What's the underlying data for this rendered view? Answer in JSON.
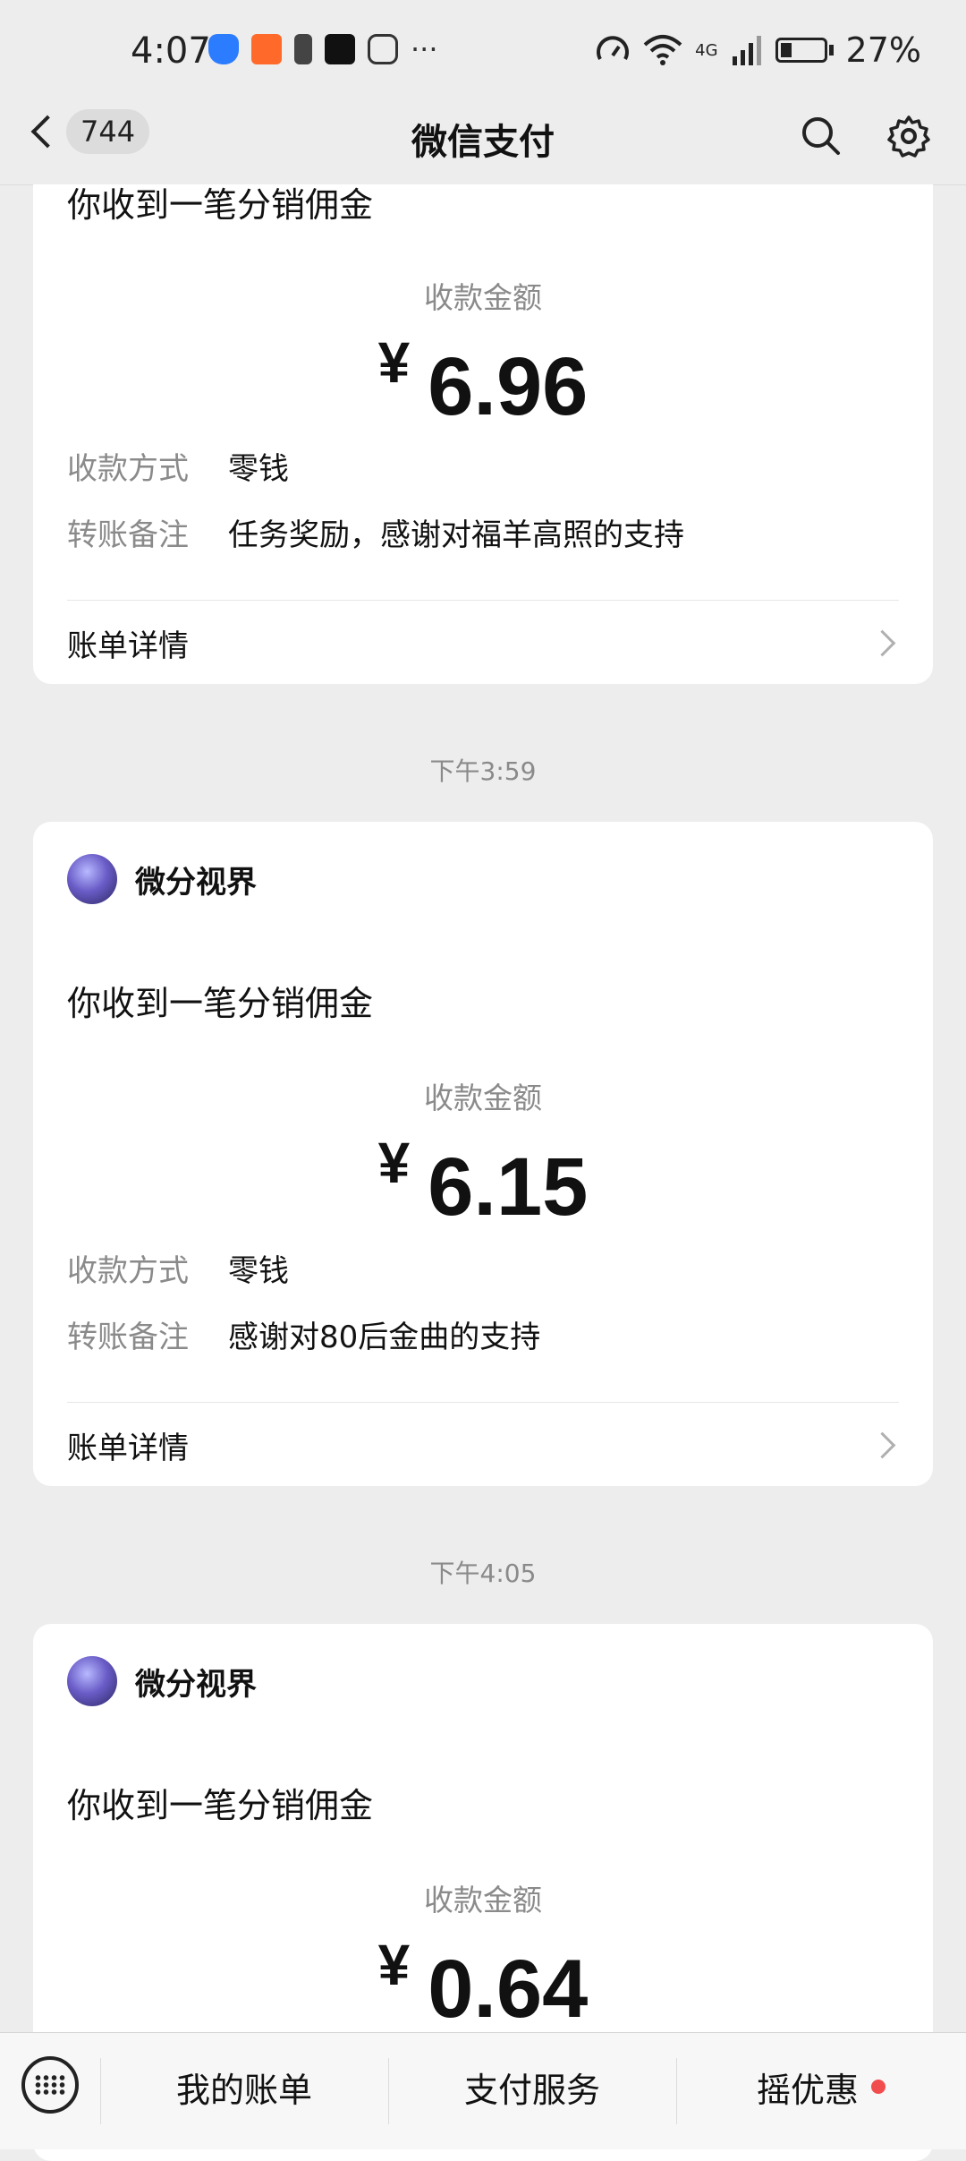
{
  "status_bar": {
    "time": "4:07",
    "network": "4G",
    "battery": "27%"
  },
  "nav": {
    "back_count": "744",
    "title": "微信支付"
  },
  "cards": [
    {
      "title": "你收到一笔分销佣金",
      "amount_label": "收款金额",
      "currency": "¥",
      "amount": "6.96",
      "method_key": "收款方式",
      "method_value": "零钱",
      "note_key": "转账备注",
      "note_value": "任务奖励，感谢对福羊高照的支持",
      "detail_label": "账单详情"
    },
    {
      "timestamp": "下午3:59",
      "sender": "微分视界",
      "title": "你收到一笔分销佣金",
      "amount_label": "收款金额",
      "currency": "¥",
      "amount": "6.15",
      "method_key": "收款方式",
      "method_value": "零钱",
      "note_key": "转账备注",
      "note_value": "感谢对80后金曲的支持",
      "detail_label": "账单详情"
    },
    {
      "timestamp": "下午4:05",
      "sender": "微分视界",
      "title": "你收到一笔分销佣金",
      "amount_label": "收款金额",
      "currency": "¥",
      "amount": "0.64"
    }
  ],
  "bottom_bar": {
    "items": [
      "我的账单",
      "支付服务",
      "摇优惠"
    ]
  },
  "colors": {
    "background": "#ededed",
    "card": "#ffffff",
    "muted_text": "#8a8a8a",
    "red_dot": "#f24d4d"
  }
}
